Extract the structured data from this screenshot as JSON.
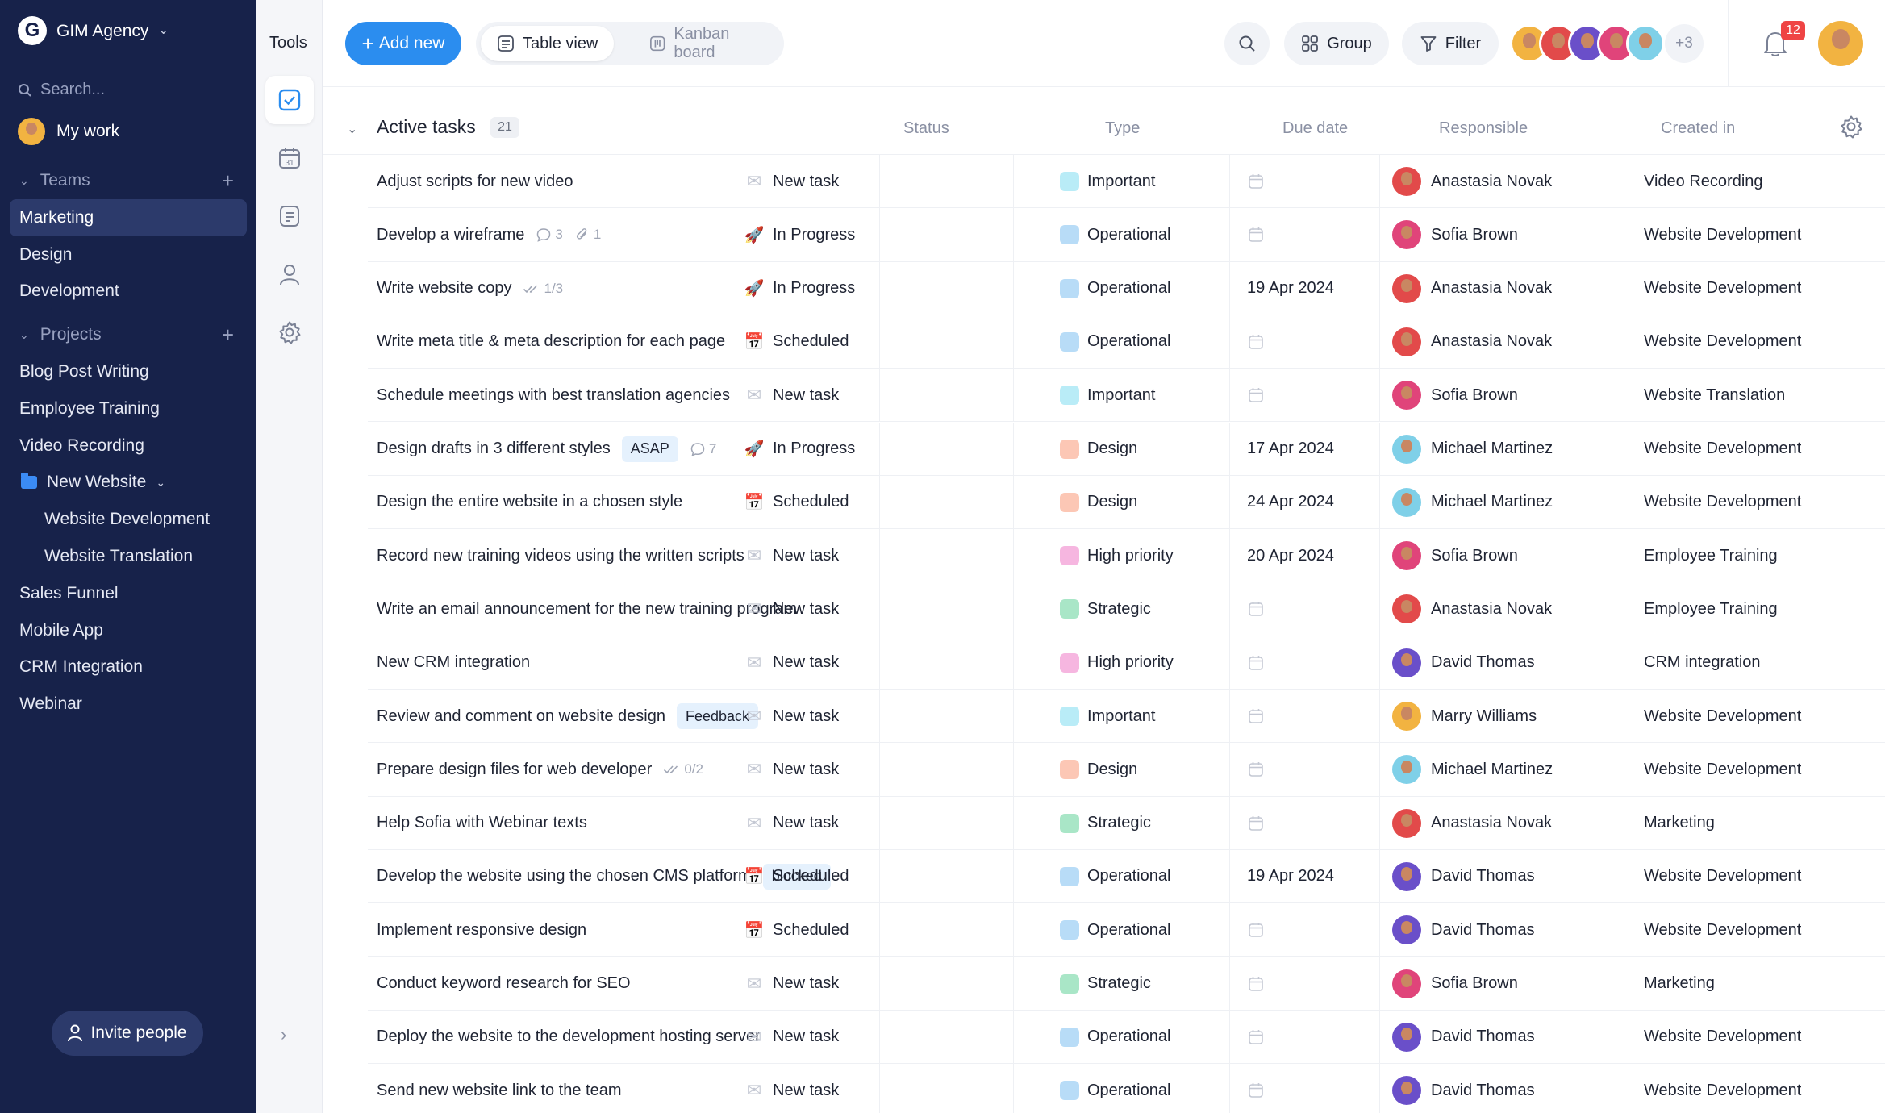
{
  "workspace": {
    "name": "GIM Agency",
    "logo_letter": "G"
  },
  "sidebar": {
    "search_placeholder": "Search...",
    "my_work": "My work",
    "teams_label": "Teams",
    "teams": [
      {
        "label": "Marketing",
        "active": true
      },
      {
        "label": "Design",
        "active": false
      },
      {
        "label": "Development",
        "active": false
      }
    ],
    "projects_label": "Projects",
    "projects": [
      {
        "label": "Blog Post Writing",
        "level": 0
      },
      {
        "label": "Employee Training",
        "level": 0
      },
      {
        "label": "Video Recording",
        "level": 0
      },
      {
        "label": "New Website",
        "level": 0,
        "folder": true,
        "expanded": true
      },
      {
        "label": "Website Development",
        "level": 1
      },
      {
        "label": "Website Translation",
        "level": 1
      },
      {
        "label": "Sales Funnel",
        "level": 0
      },
      {
        "label": "Mobile App",
        "level": 0
      },
      {
        "label": "CRM Integration",
        "level": 0
      },
      {
        "label": "Webinar",
        "level": 0
      }
    ],
    "invite_label": "Invite people"
  },
  "tools": {
    "title": "Tools",
    "items": [
      {
        "icon": "checkbox-icon",
        "active": true
      },
      {
        "icon": "calendar-icon",
        "label": "31",
        "active": false
      },
      {
        "icon": "document-icon",
        "active": false
      },
      {
        "icon": "user-icon",
        "active": false
      },
      {
        "icon": "gear-icon",
        "active": false
      }
    ]
  },
  "toolbar": {
    "add_new": "Add new",
    "views": [
      {
        "label": "Table view",
        "icon": "table-icon",
        "active": true
      },
      {
        "label": "Kanban board",
        "icon": "kanban-icon",
        "active": false
      }
    ],
    "group": "Group",
    "filter": "Filter",
    "more_members": "+3",
    "notifications_count": "12"
  },
  "table": {
    "group_title": "Active tasks",
    "group_count": "21",
    "columns": {
      "status": "Status",
      "type": "Type",
      "due": "Due date",
      "responsible": "Responsible",
      "created": "Created in"
    },
    "rows": [
      {
        "task": "Adjust scripts for new video",
        "status": "New task",
        "type": "Important",
        "due": "",
        "responsible": "Anastasia Novak",
        "created": "Video Recording"
      },
      {
        "task": "Develop a wireframe",
        "comments": "3",
        "attachments": "1",
        "status": "In Progress",
        "type": "Operational",
        "due": "",
        "responsible": "Sofia Brown",
        "created": "Website Development"
      },
      {
        "task": "Write website copy",
        "checklist": "1/3",
        "status": "In Progress",
        "type": "Operational",
        "due": "19 Apr 2024",
        "responsible": "Anastasia Novak",
        "created": "Website Development"
      },
      {
        "task": "Write meta title & meta description for each page",
        "status": "Scheduled",
        "type": "Operational",
        "due": "",
        "responsible": "Anastasia Novak",
        "created": "Website Development"
      },
      {
        "task": "Schedule meetings with best translation agencies",
        "status": "New task",
        "type": "Important",
        "due": "",
        "responsible": "Sofia Brown",
        "created": "Website Translation"
      },
      {
        "task": "Design drafts in 3 different styles",
        "tag": "ASAP",
        "comments": "7",
        "status": "In Progress",
        "type": "Design",
        "due": "17 Apr 2024",
        "responsible": "Michael Martinez",
        "created": "Website Development"
      },
      {
        "task": "Design the entire website in a chosen style",
        "status": "Scheduled",
        "type": "Design",
        "due": "24 Apr 2024",
        "responsible": "Michael Martinez",
        "created": "Website Development"
      },
      {
        "task": "Record new training videos using the written scripts",
        "status": "New task",
        "type": "High priority",
        "due": "20 Apr 2024",
        "responsible": "Sofia Brown",
        "created": "Employee Training"
      },
      {
        "task": "Write an email announcement for the new training program",
        "status": "New task",
        "type": "Strategic",
        "due": "",
        "responsible": "Anastasia Novak",
        "created": "Employee Training"
      },
      {
        "task": "New CRM integration",
        "status": "New task",
        "type": "High priority",
        "due": "",
        "responsible": "David Thomas",
        "created": "CRM integration"
      },
      {
        "task": "Review and comment on website design",
        "tag": "Feedback",
        "status": "New task",
        "type": "Important",
        "due": "",
        "responsible": "Marry Williams",
        "created": "Website Development"
      },
      {
        "task": "Prepare design files for web developer",
        "checklist": "0/2",
        "status": "New task",
        "type": "Design",
        "due": "",
        "responsible": "Michael Martinez",
        "created": "Website Development"
      },
      {
        "task": "Help Sofia with Webinar texts",
        "status": "New task",
        "type": "Strategic",
        "due": "",
        "responsible": "Anastasia Novak",
        "created": "Marketing"
      },
      {
        "task": "Develop the website using the chosen CMS platform",
        "tag": "blocked",
        "status": "Scheduled",
        "type": "Operational",
        "due": "19 Apr 2024",
        "responsible": "David Thomas",
        "created": "Website Development"
      },
      {
        "task": "Implement responsive design",
        "status": "Scheduled",
        "type": "Operational",
        "due": "",
        "responsible": "David Thomas",
        "created": "Website Development"
      },
      {
        "task": "Conduct keyword research for SEO",
        "status": "New task",
        "type": "Strategic",
        "due": "",
        "responsible": "Sofia Brown",
        "created": "Marketing"
      },
      {
        "task": "Deploy the website to the development hosting server",
        "status": "New task",
        "type": "Operational",
        "due": "",
        "responsible": "David Thomas",
        "created": "Website Development"
      },
      {
        "task": "Send new website link to the team",
        "status": "New task",
        "type": "Operational",
        "due": "",
        "responsible": "David Thomas",
        "created": "Website Development"
      }
    ]
  },
  "colors": {
    "sidebar_bg": "#17224a",
    "accent": "#2b8def",
    "type_colors": {
      "Important": "#b9ecf7",
      "Operational": "#b8dcf7",
      "Design": "#fcc7b5",
      "High priority": "#f6b6e0",
      "Strategic": "#a9e6c7"
    },
    "person_colors": {
      "Anastasia Novak": "#e24a4a",
      "Sofia Brown": "#e0447a",
      "Michael Martinez": "#7fd0e8",
      "David Thomas": "#6a4fc9",
      "Marry Williams": "#f2b341"
    }
  }
}
